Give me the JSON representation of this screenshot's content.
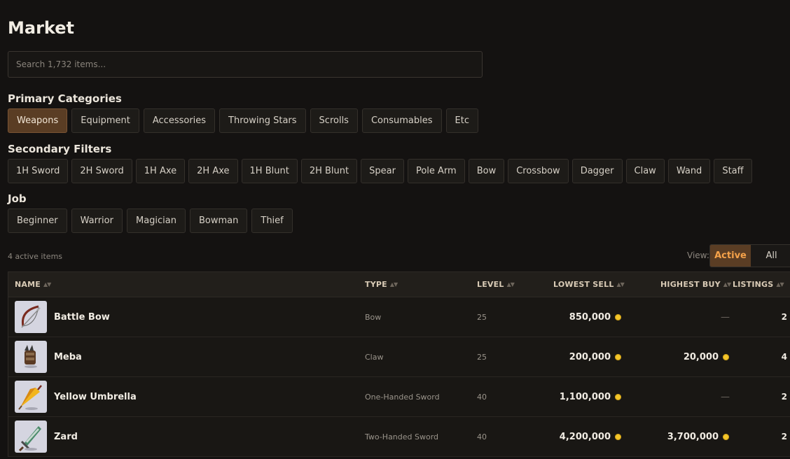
{
  "page": {
    "title": "Market"
  },
  "search": {
    "placeholder": "Search 1,732 items..."
  },
  "primary": {
    "label": "Primary Categories",
    "items": [
      "Weapons",
      "Equipment",
      "Accessories",
      "Throwing Stars",
      "Scrolls",
      "Consumables",
      "Etc"
    ],
    "active": "Weapons"
  },
  "secondary": {
    "label": "Secondary Filters",
    "items": [
      "1H Sword",
      "2H Sword",
      "1H Axe",
      "2H Axe",
      "1H Blunt",
      "2H Blunt",
      "Spear",
      "Pole Arm",
      "Bow",
      "Crossbow",
      "Dagger",
      "Claw",
      "Wand",
      "Staff"
    ]
  },
  "job": {
    "label": "Job",
    "items": [
      "Beginner",
      "Warrior",
      "Magician",
      "Bowman",
      "Thief"
    ]
  },
  "summary": {
    "active_count": "4 active items"
  },
  "view": {
    "label": "View:",
    "options": [
      "Active",
      "All"
    ],
    "selected": "Active"
  },
  "table": {
    "columns": [
      "NAME",
      "TYPE",
      "LEVEL",
      "LOWEST SELL",
      "HIGHEST BUY",
      "LISTINGS"
    ],
    "sort_glyph": "▲▼",
    "rows": [
      {
        "icon": "bow-icon",
        "name": "Battle Bow",
        "type": "Bow",
        "level": "25",
        "lowest_sell": "850,000",
        "highest_buy": "—",
        "listings": "2"
      },
      {
        "icon": "claw-icon",
        "name": "Meba",
        "type": "Claw",
        "level": "25",
        "lowest_sell": "200,000",
        "highest_buy": "20,000",
        "listings": "4"
      },
      {
        "icon": "umbrella-icon",
        "name": "Yellow Umbrella",
        "type": "One-Handed Sword",
        "level": "40",
        "lowest_sell": "1,100,000",
        "highest_buy": "—",
        "listings": "2"
      },
      {
        "icon": "sword-icon",
        "name": "Zard",
        "type": "Two-Handed Sword",
        "level": "40",
        "lowest_sell": "4,200,000",
        "highest_buy": "3,700,000",
        "listings": "2"
      }
    ]
  },
  "colors": {
    "accent": "#5a3d24",
    "accent_text": "#f5a24a",
    "coin": "#f3c62b",
    "background": "#141211"
  }
}
